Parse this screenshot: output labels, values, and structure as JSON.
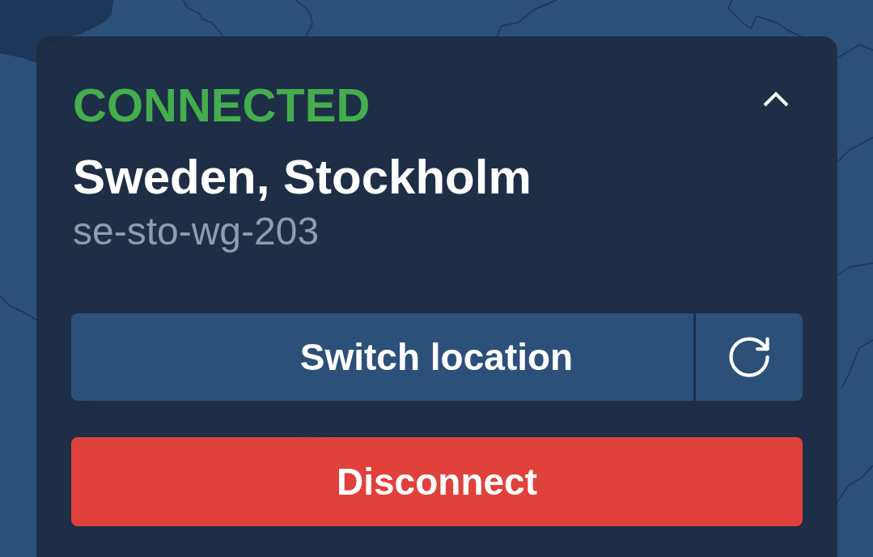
{
  "panel": {
    "expanded": true
  },
  "status": {
    "kind": "connected",
    "label": "CONNECTED"
  },
  "location": {
    "title": "Sweden, Stockholm",
    "server": "se-sto-wg-203"
  },
  "switch_location": {
    "label": "Switch location"
  },
  "disconnect": {
    "label": "Disconnect"
  }
}
